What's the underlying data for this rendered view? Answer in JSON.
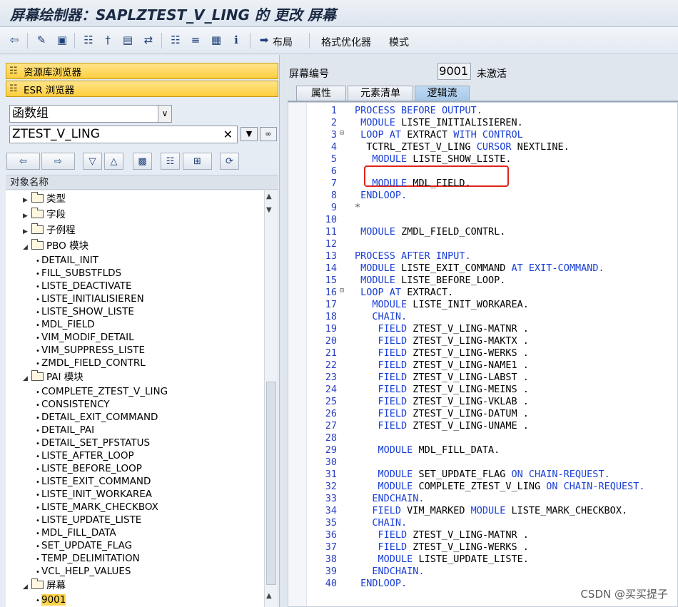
{
  "window": {
    "title": "屏幕绘制器：SAPLZTEST_V_LING 的 更改 屏幕"
  },
  "toolbar": {
    "layout_label": "布局",
    "formatter_label": "格式优化器",
    "mode_label": "模式",
    "icons": [
      "back-arrow-icon",
      "edit-toggle-icon",
      "save-icon",
      "hierarchy-icon",
      "activate-icon",
      "display-icon",
      "where-used-icon",
      "structure-icon",
      "element-list-icon",
      "table-icon",
      "info-icon",
      "layout-arrow-icon"
    ]
  },
  "left_panel": {
    "nav_buttons": [
      {
        "label": "资源库浏览器",
        "icon": "repository-icon"
      },
      {
        "label": "ESR 浏览器",
        "icon": "esr-icon"
      }
    ],
    "object_type": "函数组",
    "object_name": "ZTEST_V_LING",
    "tree_header": "对象名称",
    "tree": [
      {
        "label": "类型",
        "kind": "folder",
        "expanded": false
      },
      {
        "label": "字段",
        "kind": "folder",
        "expanded": false
      },
      {
        "label": "子例程",
        "kind": "folder",
        "expanded": false
      },
      {
        "label": "PBO 模块",
        "kind": "folder",
        "expanded": true
      },
      {
        "label": "DETAIL_INIT",
        "kind": "leaf"
      },
      {
        "label": "FILL_SUBSTFLDS",
        "kind": "leaf"
      },
      {
        "label": "LISTE_DEACTIVATE",
        "kind": "leaf"
      },
      {
        "label": "LISTE_INITIALISIEREN",
        "kind": "leaf"
      },
      {
        "label": "LISTE_SHOW_LISTE",
        "kind": "leaf"
      },
      {
        "label": "MDL_FIELD",
        "kind": "leaf"
      },
      {
        "label": "VIM_MODIF_DETAIL",
        "kind": "leaf"
      },
      {
        "label": "VIM_SUPPRESS_LISTE",
        "kind": "leaf"
      },
      {
        "label": "ZMDL_FIELD_CONTRL",
        "kind": "leaf"
      },
      {
        "label": "PAI 模块",
        "kind": "folder",
        "expanded": true
      },
      {
        "label": "COMPLETE_ZTEST_V_LING",
        "kind": "leaf"
      },
      {
        "label": "CONSISTENCY",
        "kind": "leaf"
      },
      {
        "label": "DETAIL_EXIT_COMMAND",
        "kind": "leaf"
      },
      {
        "label": "DETAIL_PAI",
        "kind": "leaf"
      },
      {
        "label": "DETAIL_SET_PFSTATUS",
        "kind": "leaf"
      },
      {
        "label": "LISTE_AFTER_LOOP",
        "kind": "leaf"
      },
      {
        "label": "LISTE_BEFORE_LOOP",
        "kind": "leaf"
      },
      {
        "label": "LISTE_EXIT_COMMAND",
        "kind": "leaf"
      },
      {
        "label": "LISTE_INIT_WORKAREA",
        "kind": "leaf"
      },
      {
        "label": "LISTE_MARK_CHECKBOX",
        "kind": "leaf"
      },
      {
        "label": "LISTE_UPDATE_LISTE",
        "kind": "leaf"
      },
      {
        "label": "MDL_FILL_DATA",
        "kind": "leaf"
      },
      {
        "label": "SET_UPDATE_FLAG",
        "kind": "leaf"
      },
      {
        "label": "TEMP_DELIMITATION",
        "kind": "leaf"
      },
      {
        "label": "VCL_HELP_VALUES",
        "kind": "leaf"
      },
      {
        "label": "屏幕",
        "kind": "folder",
        "expanded": true
      },
      {
        "label": "9001",
        "kind": "leaf",
        "selected": true
      }
    ]
  },
  "screen": {
    "number_label": "屏幕编号",
    "number": "9001",
    "status": "未激活",
    "tabs": [
      "属性",
      "元素清单",
      "逻辑流"
    ],
    "active_tab": "逻辑流"
  },
  "code_lines": [
    "PROCESS BEFORE OUTPUT.",
    " MODULE LISTE_INITIALISIEREN.",
    " LOOP AT EXTRACT WITH CONTROL",
    "  TCTRL_ZTEST_V_LING CURSOR NEXTLINE.",
    "   MODULE LISTE_SHOW_LISTE.",
    "",
    "   MODULE MDL_FIELD.",
    " ENDLOOP.",
    "*",
    "",
    " MODULE ZMDL_FIELD_CONTRL.",
    "",
    "PROCESS AFTER INPUT.",
    " MODULE LISTE_EXIT_COMMAND AT EXIT-COMMAND.",
    " MODULE LISTE_BEFORE_LOOP.",
    " LOOP AT EXTRACT.",
    "   MODULE LISTE_INIT_WORKAREA.",
    "   CHAIN.",
    "    FIELD ZTEST_V_LING-MATNR .",
    "    FIELD ZTEST_V_LING-MAKTX .",
    "    FIELD ZTEST_V_LING-WERKS .",
    "    FIELD ZTEST_V_LING-NAME1 .",
    "    FIELD ZTEST_V_LING-LABST .",
    "    FIELD ZTEST_V_LING-MEINS .",
    "    FIELD ZTEST_V_LING-VKLAB .",
    "    FIELD ZTEST_V_LING-DATUM .",
    "    FIELD ZTEST_V_LING-UNAME .",
    "",
    "    MODULE MDL_FILL_DATA.",
    "",
    "    MODULE SET_UPDATE_FLAG ON CHAIN-REQUEST.",
    "    MODULE COMPLETE_ZTEST_V_LING ON CHAIN-REQUEST.",
    "   ENDCHAIN.",
    "   FIELD VIM_MARKED MODULE LISTE_MARK_CHECKBOX.",
    "   CHAIN.",
    "    FIELD ZTEST_V_LING-MATNR .",
    "    FIELD ZTEST_V_LING-WERKS .",
    "    MODULE LISTE_UPDATE_LISTE.",
    "   ENDCHAIN.",
    " ENDLOOP."
  ],
  "fold_lines": [
    3,
    16
  ],
  "watermark": "CSDN @买买提子",
  "colors": {
    "keyword": "#1a3fd6",
    "highlight_box": "#e0241a",
    "selection": "#ffd34d",
    "nav_button": "#ffcf3e"
  }
}
